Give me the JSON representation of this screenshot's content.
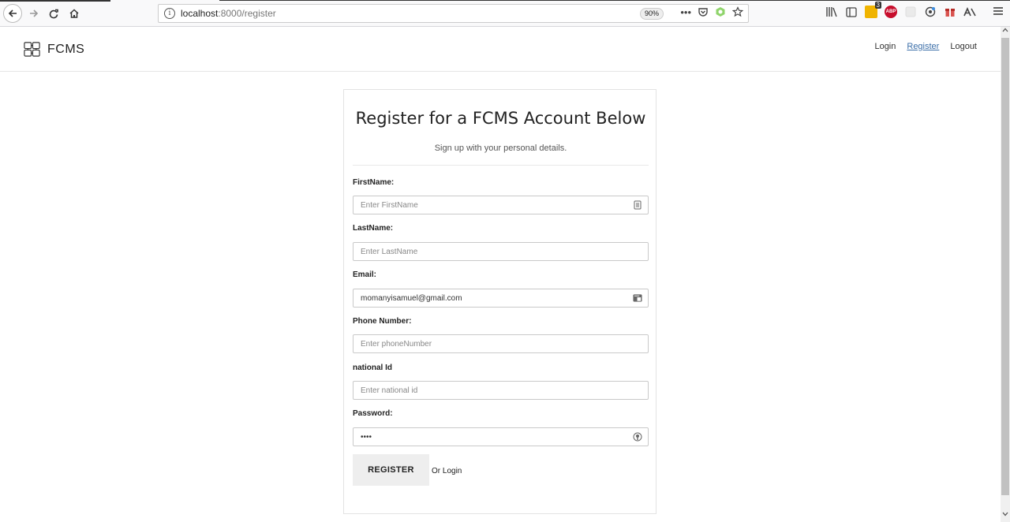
{
  "browser": {
    "url_host": "localhost",
    "url_path": ":8000/register",
    "zoom": "90%",
    "ext_badge_count": "3",
    "abp_label": "ABP"
  },
  "site": {
    "brand": "FCMS",
    "nav": {
      "login": "Login",
      "register": "Register",
      "logout": "Logout"
    }
  },
  "form": {
    "title": "Register for a FCMS Account Below",
    "subtitle": "Sign up with your personal details.",
    "fields": {
      "firstname": {
        "label": "FirstName:",
        "placeholder": "Enter FirstName",
        "value": ""
      },
      "lastname": {
        "label": "LastName:",
        "placeholder": "Enter LastName",
        "value": ""
      },
      "email": {
        "label": "Email:",
        "placeholder": "",
        "value": "momanyisamuel@gmail.com"
      },
      "phone": {
        "label": "Phone Number:",
        "placeholder": "Enter phoneNumber",
        "value": ""
      },
      "national_id": {
        "label": "national Id",
        "placeholder": "Enter national id",
        "value": ""
      },
      "password": {
        "label": "Password:",
        "placeholder": "",
        "value": "••••"
      }
    },
    "register_button": "REGISTER",
    "or_login": "Or Login"
  }
}
